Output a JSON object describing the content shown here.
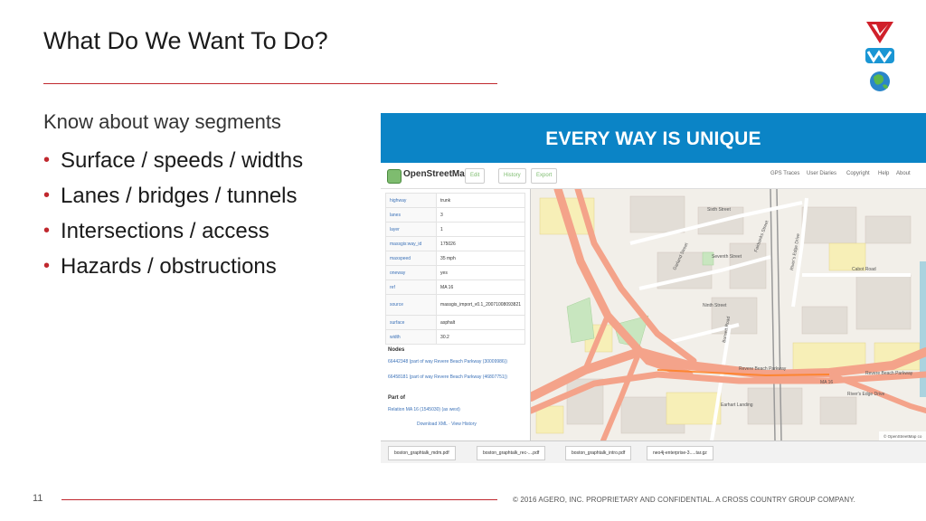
{
  "slide": {
    "title": "What Do We Want To Do?",
    "lead": "Know about way segments",
    "bullets": [
      "Surface / speeds / widths",
      "Lanes / bridges / tunnels",
      "Intersections / access",
      "Hazards / obstructions"
    ],
    "banner": "EVERY WAY IS UNIQUE",
    "page_number": "11",
    "copyright": "© 2016 AGERO, INC. PROPRIETARY AND CONFIDENTIAL. A CROSS COUNTRY GROUP COMPANY."
  },
  "osm": {
    "brand": "OpenStreetMap",
    "buttons": [
      "Edit",
      "History",
      "Export"
    ],
    "nav": [
      "GPS Traces",
      "User Diaries",
      "Copyright",
      "Help",
      "About"
    ],
    "tags": [
      {
        "k": "highway",
        "v": "trunk"
      },
      {
        "k": "lanes",
        "v": "3"
      },
      {
        "k": "layer",
        "v": "1"
      },
      {
        "k": "massgis:way_id",
        "v": "175026"
      },
      {
        "k": "maxspeed",
        "v": "35 mph"
      },
      {
        "k": "oneway",
        "v": "yes"
      },
      {
        "k": "ref",
        "v": "MA 16"
      },
      {
        "k": "source",
        "v": "massgis_import_v0.1_20071008093821"
      },
      {
        "k": "surface",
        "v": "asphalt"
      },
      {
        "k": "width",
        "v": "30.2"
      }
    ],
    "nodes_heading": "Nodes",
    "nodes": [
      "66442348 (part of way Revere Beach Parkway (30009986))",
      "66458181 (part of way Revere Beach Parkway (46807751))"
    ],
    "part_of_heading": "Part of",
    "relation": "Relation MA 16 (1545030) (as west)",
    "links": "Download XML · View History",
    "map_labels": {
      "sixth_st": "Sixth Street",
      "seventh_st": "Seventh Street",
      "ninth_st": "Ninth Street",
      "rivers_edge": "River's Edge Drive",
      "cabot_rd": "Cabot Road",
      "revere_beach": "Revere Beach Parkway",
      "garland": "Garland Street",
      "fairbanks": "Fairbanks Street",
      "burnett": "Burnett Road",
      "earhart": "Earhart Landing",
      "ma16": "MA 16",
      "attribution": "© OpenStreetMap co"
    },
    "downloads": [
      "boston_graphtalk_mdm.pdf",
      "boston_graphtalk_rec-....pdf",
      "boston_graphtalk_intro.pdf",
      "neo4j-enterprise-3.....tar.gz"
    ]
  },
  "colors": {
    "accent_red": "#c0282e",
    "banner_blue": "#0b84c6",
    "road_trunk": "#f4a38a",
    "map_bg": "#f2efe9"
  }
}
